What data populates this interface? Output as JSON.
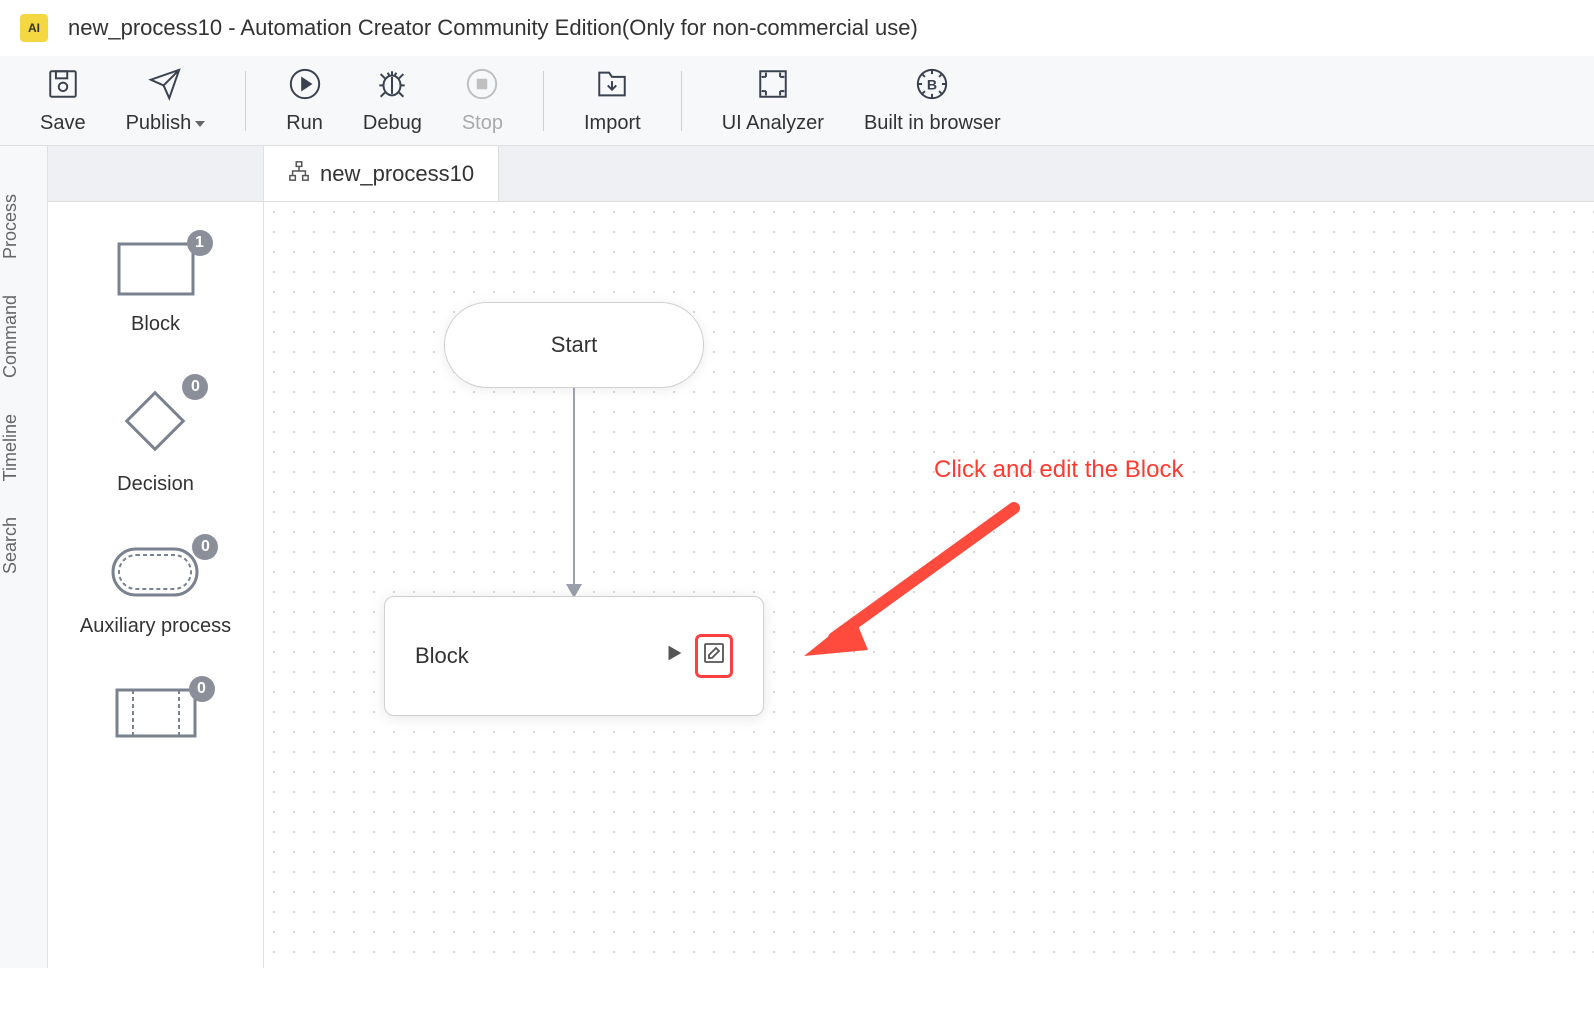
{
  "app": {
    "logo_text": "AI",
    "title": "new_process10 - Automation Creator Community Edition(Only for non-commercial use)"
  },
  "toolbar": {
    "save": "Save",
    "publish": "Publish",
    "run": "Run",
    "debug": "Debug",
    "stop": "Stop",
    "import": "Import",
    "ui_analyzer": "UI Analyzer",
    "built_in_browser": "Built in browser"
  },
  "side_tabs": {
    "process": "Process",
    "command": "Command",
    "timeline": "Timeline",
    "search": "Search"
  },
  "tab": {
    "name": "new_process10"
  },
  "palette": {
    "block": {
      "label": "Block",
      "count": "1"
    },
    "decision": {
      "label": "Decision",
      "count": "0"
    },
    "auxiliary": {
      "label": "Auxiliary process",
      "count": "0"
    },
    "fourth": {
      "count": "0"
    }
  },
  "canvas": {
    "start_label": "Start",
    "block_label": "Block"
  },
  "hint": {
    "text": "Click and edit the Block"
  }
}
